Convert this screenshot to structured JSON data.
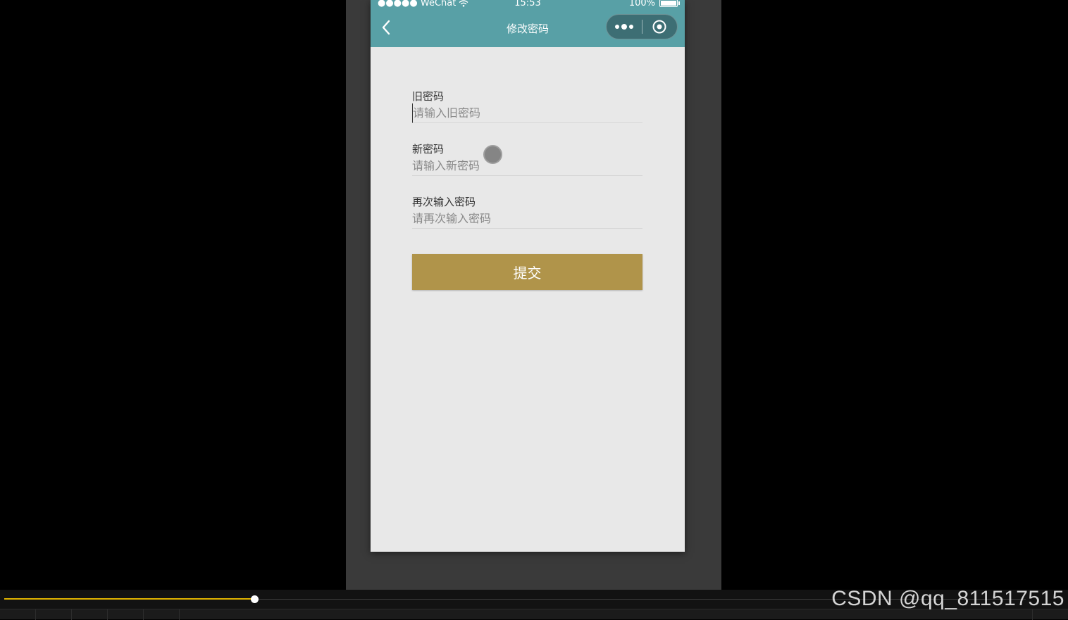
{
  "status_bar": {
    "carrier": "●●●●● WeChat",
    "time": "15:53",
    "battery": "100%"
  },
  "nav": {
    "title": "修改密码"
  },
  "form": {
    "old_password": {
      "label": "旧密码",
      "placeholder": "请输入旧密码"
    },
    "new_password": {
      "label": "新密码",
      "placeholder": "请输入新密码"
    },
    "confirm_password": {
      "label": "再次输入密码",
      "placeholder": "请再次输入密码"
    },
    "submit_label": "提交"
  },
  "player": {
    "progress": 0.245
  },
  "watermark": "CSDN @qq_811517515",
  "colors": {
    "nav_background": "#58a0a6",
    "submit_button": "#b0944a",
    "progress_accent": "#e0b400",
    "page_background": "#e8e8e8"
  }
}
